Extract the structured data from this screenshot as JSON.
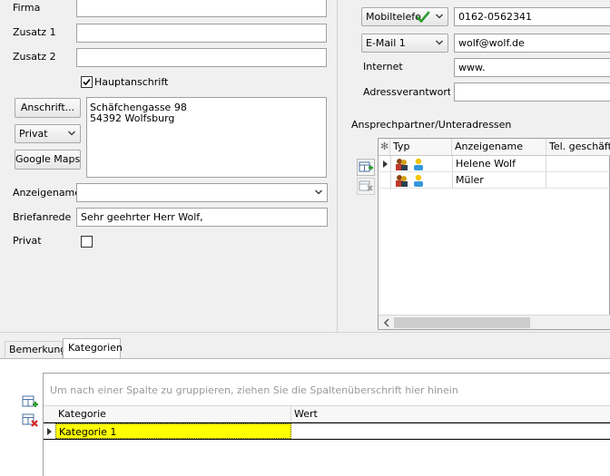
{
  "left": {
    "firma_label": "Firma",
    "zusatz1_label": "Zusatz 1",
    "zusatz2_label": "Zusatz 2",
    "hauptanschrift_label": "Hauptanschrift",
    "anschrift_button": "Anschrift...",
    "address_type_value": "Privat",
    "google_maps_button": "Google Maps",
    "address_line1": "Schäfchengasse 98",
    "address_line2": "54392 Wolfsburg",
    "anzeigename_label": "Anzeigename",
    "anzeigename_value": "",
    "briefanrede_label": "Briefanrede",
    "briefanrede_value": "Sehr geehrter Herr Wolf,",
    "privat_label": "Privat"
  },
  "right": {
    "mobil_combo": "Mobiltelefo",
    "mobil_value": "0162-0562341",
    "email_combo": "E-Mail 1",
    "email_value": "wolf@wolf.de",
    "internet_label": "Internet",
    "internet_value": "www.",
    "adressverantwortlich_label": "Adressverantwortlic",
    "ansprech_title": "Ansprechpartner/Unteradressen",
    "grid": {
      "headers": [
        "Typ",
        "Anzeigename",
        "Tel. geschäftlic"
      ],
      "rows": [
        {
          "name": "Helene Wolf"
        },
        {
          "name": "Müler"
        }
      ]
    }
  },
  "tabs": [
    {
      "label": "Bemerkung"
    },
    {
      "label": "Kategorien"
    }
  ],
  "kategorien": {
    "group_hint": "Um nach einer Spalte zu gruppieren, ziehen Sie die Spaltenüberschrift hier hinein",
    "headers": [
      "Kategorie",
      "Wert"
    ],
    "rows": [
      {
        "kategorie": "Kategorie 1",
        "wert": ""
      }
    ]
  },
  "colors": {
    "selected_row": "#ffff00",
    "check_green": "#2e9d2e"
  }
}
